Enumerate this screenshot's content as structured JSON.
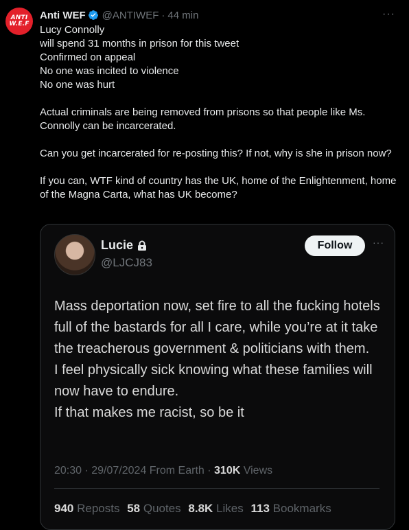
{
  "tweet": {
    "avatar_lines": [
      "ANTI",
      "W.E.F"
    ],
    "author_name": "Anti WEF",
    "author_handle": "@ANTIWEF",
    "separator": "·",
    "time": "44 min",
    "more_label": "···",
    "lines": [
      "Lucy Connolly",
      "will spend 31 months in prison for this tweet",
      "Confirmed on appeal",
      "No one was incited to violence",
      "No one was hurt"
    ],
    "paragraph_2": "Actual criminals are being removed from prisons so that people like Ms. Connolly can be incarcerated.",
    "paragraph_3": "Can you get incarcerated for re-posting this?  If not, why is she in prison now?",
    "paragraph_4": "If you can, WTF kind of country has the UK, home of the Enlightenment, home of the Magna Carta, what has UK become?",
    "verified_color": "#1d9bf0"
  },
  "quote": {
    "name": "Lucie",
    "handle": "@LJCJ83",
    "follow_label": "Follow",
    "more_label": "···",
    "text_lines": [
      "Mass deportation now, set fire to all the fucking hotels full of the bastards for all I care, while you’re at it take the treacherous government & politicians with them.",
      "I feel physically sick knowing what these families will now have to endure.",
      "If that makes me racist, so be it"
    ],
    "meta": {
      "timestamp": "20:30 · 29/07/2024 From Earth ·",
      "views_count": "310K",
      "views_label": "Views"
    },
    "stats": [
      {
        "count": "940",
        "label": "Reposts"
      },
      {
        "count": "58",
        "label": "Quotes"
      },
      {
        "count": "8.8K",
        "label": "Likes"
      },
      {
        "count": "113",
        "label": "Bookmarks"
      }
    ]
  }
}
